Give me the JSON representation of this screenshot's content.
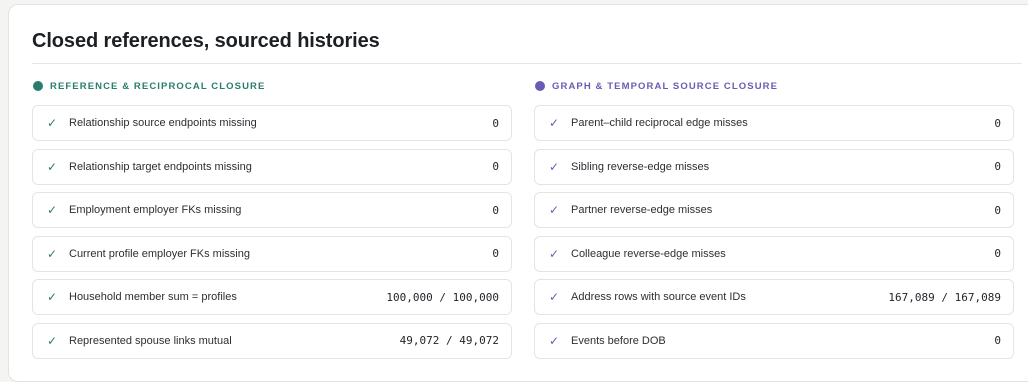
{
  "panel": {
    "title": "Closed references, sourced histories"
  },
  "colors": {
    "teal": "#2a7d6e",
    "purple": "#6b5bb3"
  },
  "left": {
    "heading": "REFERENCE & RECIPROCAL CLOSURE",
    "check_icon": "✓",
    "rows": [
      {
        "label": "Relationship source endpoints missing",
        "value": "0"
      },
      {
        "label": "Relationship target endpoints missing",
        "value": "0"
      },
      {
        "label": "Employment employer FKs missing",
        "value": "0"
      },
      {
        "label": "Current profile employer FKs missing",
        "value": "0"
      },
      {
        "label": "Household member sum = profiles",
        "value": "100,000 / 100,000"
      },
      {
        "label": "Represented spouse links mutual",
        "value": "49,072 / 49,072"
      }
    ]
  },
  "right": {
    "heading": "GRAPH & TEMPORAL SOURCE CLOSURE",
    "check_icon": "✓",
    "rows": [
      {
        "label": "Parent–child reciprocal edge misses",
        "value": "0"
      },
      {
        "label": "Sibling reverse-edge misses",
        "value": "0"
      },
      {
        "label": "Partner reverse-edge misses",
        "value": "0"
      },
      {
        "label": "Colleague reverse-edge misses",
        "value": "0"
      },
      {
        "label": "Address rows with source event IDs",
        "value": "167,089 / 167,089"
      },
      {
        "label": "Events before DOB",
        "value": "0"
      }
    ]
  }
}
